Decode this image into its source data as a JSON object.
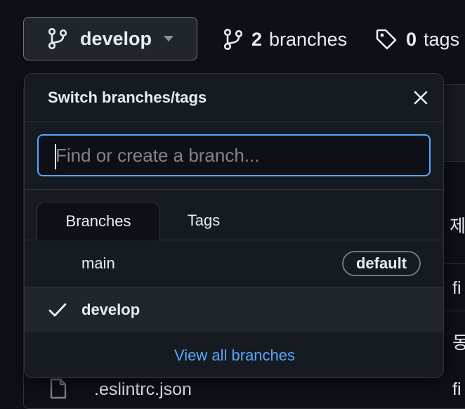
{
  "topbar": {
    "branch_button_label": "develop",
    "branches_count": "2",
    "branches_label": "branches",
    "tags_count": "0",
    "tags_label": "tags"
  },
  "dropdown": {
    "title": "Switch branches/tags",
    "filter_placeholder": "Find or create a branch...",
    "filter_value": "",
    "tabs": [
      {
        "label": "Branches",
        "active": true
      },
      {
        "label": "Tags",
        "active": false
      }
    ],
    "items": [
      {
        "name": "main",
        "badge": "default",
        "selected": false
      },
      {
        "name": "develop",
        "badge": "",
        "selected": true
      }
    ],
    "footer_link": "View all branches"
  },
  "background": {
    "header_fragment": "제",
    "row_fragments": [
      "fi",
      "동"
    ],
    "file_name": ".eslintrc.json",
    "file_commit_fragment": "fi"
  },
  "colors": {
    "page_bg": "#0d1117",
    "panel_bg": "#161b22",
    "border": "#30363d",
    "accent": "#58a6ff",
    "text": "#e6edf3"
  },
  "icons": [
    "git-branch-icon",
    "chevron-down-icon",
    "tag-icon",
    "close-icon",
    "check-icon",
    "file-icon"
  ]
}
